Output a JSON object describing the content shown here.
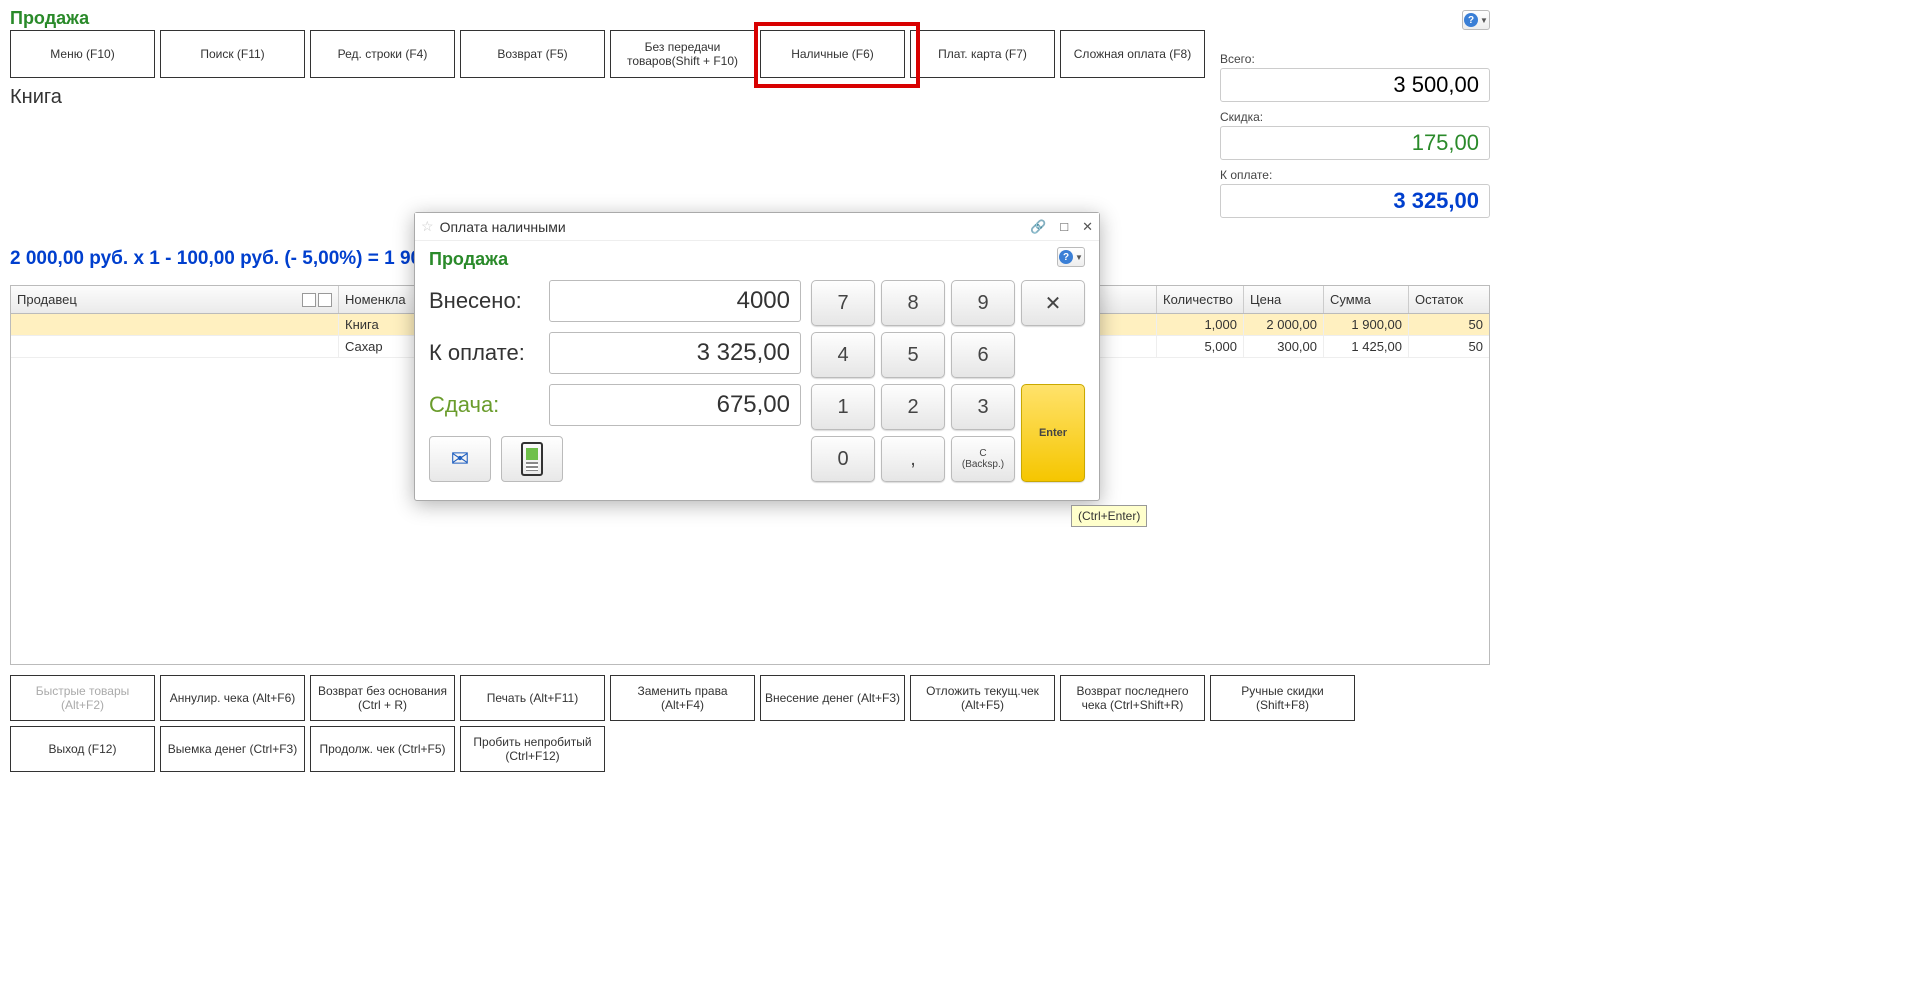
{
  "page_title": "Продажа",
  "top_buttons": [
    "Меню (F10)",
    "Поиск (F11)",
    "Ред. строки (F4)",
    "Возврат (F5)",
    "Без передачи товаров(Shift + F10)",
    "Наличные (F6)",
    "Плат. карта (F7)",
    "Сложная оплата (F8)"
  ],
  "totals": {
    "total_label": "Всего:",
    "total_value": "3 500,00",
    "discount_label": "Скидка:",
    "discount_value": "175,00",
    "topay_label": "К оплате:",
    "topay_value": "3 325,00"
  },
  "item_title": "Книга",
  "line_summary": "2 000,00 руб. x 1  - 100,00 руб. (- 5,00%) = 1 90",
  "table": {
    "headers": {
      "seller": "Продавец",
      "nomen": "Номенкла",
      "qty": "Количество",
      "price": "Цена",
      "sum": "Сумма",
      "stock": "Остаток"
    },
    "rows": [
      {
        "seller": "",
        "nomen": "Книга",
        "qty": "1,000",
        "price": "2 000,00",
        "sum": "1 900,00",
        "stock": "50",
        "selected": true
      },
      {
        "seller": "",
        "nomen": "Сахар",
        "qty": "5,000",
        "price": "300,00",
        "sum": "1 425,00",
        "stock": "50",
        "selected": false
      }
    ]
  },
  "bottom_buttons_row1": [
    "Быстрые товары (Alt+F2)",
    "Аннулир. чека (Alt+F6)",
    "Возврат без основания (Ctrl + R)",
    "Печать (Alt+F11)",
    "Заменить права (Alt+F4)",
    "Внесение денег (Alt+F3)",
    "Отложить текущ.чек (Alt+F5)",
    "Возврат последнего чека (Ctrl+Shift+R)",
    "Ручные скидки (Shift+F8)",
    "Выход (F12)"
  ],
  "bottom_buttons_row2": [
    "Выемка денег (Ctrl+F3)",
    "Продолж. чек (Ctrl+F5)",
    "Пробить непробитый (Ctrl+F12)"
  ],
  "dialog": {
    "title": "Оплата наличными",
    "subtitle": "Продажа",
    "paid_label": "Внесено:",
    "paid_value": "4000",
    "topay_label": "К оплате:",
    "topay_value": "3 325,00",
    "change_label": "Сдача:",
    "change_value": "675,00",
    "keys": {
      "k7": "7",
      "k8": "8",
      "k9": "9",
      "kx": "✕",
      "k4": "4",
      "k5": "5",
      "k6": "6",
      "k1": "1",
      "k2": "2",
      "k3": "3",
      "enter": "Enter",
      "k0": "0",
      "kcomma": ",",
      "kc1": "C",
      "kc2": "(Backsp.)"
    },
    "tooltip": "(Ctrl+Enter)"
  }
}
